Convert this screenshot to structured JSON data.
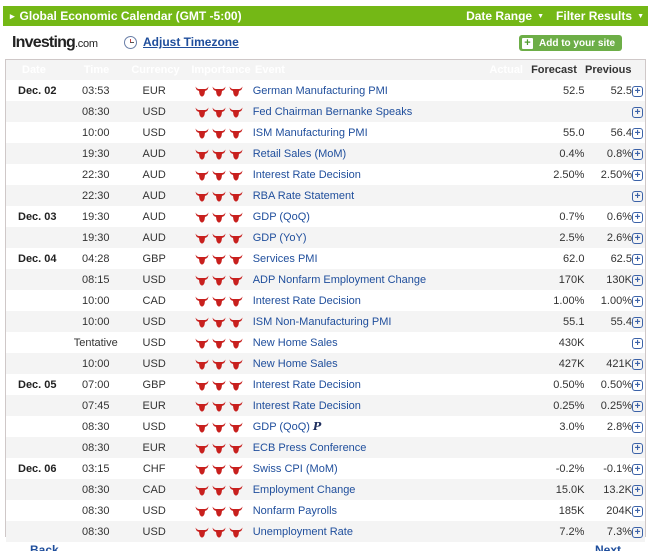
{
  "topbar": {
    "title": "Global Economic Calendar (GMT -5:00)",
    "menus": [
      {
        "label": "Date Range"
      },
      {
        "label": "Filter Results"
      }
    ]
  },
  "subbar": {
    "logo_main": "Investing",
    "logo_suffix": ".com",
    "adjust_timezone": "Adjust Timezone",
    "add_to_site": "Add to your site"
  },
  "table": {
    "headers": {
      "date": "Date",
      "time": "Time",
      "currency": "Currency",
      "importance": "Importance",
      "event": "Event",
      "actual": "Actual",
      "forecast": "Forecast",
      "previous": "Previous"
    },
    "rows": [
      {
        "date": "Dec. 02",
        "time": "03:53",
        "currency": "EUR",
        "importance": 3,
        "event": "German Manufacturing PMI",
        "actual": "",
        "forecast": "52.5",
        "previous": "52.5"
      },
      {
        "date": "",
        "time": "08:30",
        "currency": "USD",
        "importance": 3,
        "event": "Fed Chairman Bernanke Speaks",
        "actual": "",
        "forecast": "",
        "previous": ""
      },
      {
        "date": "",
        "time": "10:00",
        "currency": "USD",
        "importance": 3,
        "event": "ISM Manufacturing PMI",
        "actual": "",
        "forecast": "55.0",
        "previous": "56.4"
      },
      {
        "date": "",
        "time": "19:30",
        "currency": "AUD",
        "importance": 3,
        "event": "Retail Sales (MoM)",
        "actual": "",
        "forecast": "0.4%",
        "previous": "0.8%"
      },
      {
        "date": "",
        "time": "22:30",
        "currency": "AUD",
        "importance": 3,
        "event": "Interest Rate Decision",
        "actual": "",
        "forecast": "2.50%",
        "previous": "2.50%"
      },
      {
        "date": "",
        "time": "22:30",
        "currency": "AUD",
        "importance": 3,
        "event": "RBA Rate Statement",
        "actual": "",
        "forecast": "",
        "previous": ""
      },
      {
        "date": "Dec. 03",
        "time": "19:30",
        "currency": "AUD",
        "importance": 3,
        "event": "GDP (QoQ)",
        "actual": "",
        "forecast": "0.7%",
        "previous": "0.6%"
      },
      {
        "date": "",
        "time": "19:30",
        "currency": "AUD",
        "importance": 3,
        "event": "GDP (YoY)",
        "actual": "",
        "forecast": "2.5%",
        "previous": "2.6%"
      },
      {
        "date": "Dec. 04",
        "time": "04:28",
        "currency": "GBP",
        "importance": 3,
        "event": "Services PMI",
        "actual": "",
        "forecast": "62.0",
        "previous": "62.5"
      },
      {
        "date": "",
        "time": "08:15",
        "currency": "USD",
        "importance": 3,
        "event": "ADP Nonfarm Employment Change",
        "actual": "",
        "forecast": "170K",
        "previous": "130K"
      },
      {
        "date": "",
        "time": "10:00",
        "currency": "CAD",
        "importance": 3,
        "event": "Interest Rate Decision",
        "actual": "",
        "forecast": "1.00%",
        "previous": "1.00%"
      },
      {
        "date": "",
        "time": "10:00",
        "currency": "USD",
        "importance": 3,
        "event": "ISM Non-Manufacturing PMI",
        "actual": "",
        "forecast": "55.1",
        "previous": "55.4"
      },
      {
        "date": "",
        "time": "Tentative",
        "currency": "USD",
        "importance": 3,
        "event": "New Home Sales",
        "actual": "",
        "forecast": "430K",
        "previous": ""
      },
      {
        "date": "",
        "time": "10:00",
        "currency": "USD",
        "importance": 3,
        "event": "New Home Sales",
        "actual": "",
        "forecast": "427K",
        "previous": "421K"
      },
      {
        "date": "Dec. 05",
        "time": "07:00",
        "currency": "GBP",
        "importance": 3,
        "event": "Interest Rate Decision",
        "actual": "",
        "forecast": "0.50%",
        "previous": "0.50%"
      },
      {
        "date": "",
        "time": "07:45",
        "currency": "EUR",
        "importance": 3,
        "event": "Interest Rate Decision",
        "actual": "",
        "forecast": "0.25%",
        "previous": "0.25%"
      },
      {
        "date": "",
        "time": "08:30",
        "currency": "USD",
        "importance": 3,
        "event": "GDP (QoQ)",
        "prelim": "P",
        "actual": "",
        "forecast": "3.0%",
        "previous": "2.8%"
      },
      {
        "date": "",
        "time": "08:30",
        "currency": "EUR",
        "importance": 3,
        "event": "ECB Press Conference",
        "actual": "",
        "forecast": "",
        "previous": ""
      },
      {
        "date": "Dec. 06",
        "time": "03:15",
        "currency": "CHF",
        "importance": 3,
        "event": "Swiss CPI (MoM)",
        "actual": "",
        "forecast": "-0.2%",
        "previous": "-0.1%"
      },
      {
        "date": "",
        "time": "08:30",
        "currency": "CAD",
        "importance": 3,
        "event": "Employment Change",
        "actual": "",
        "forecast": "15.0K",
        "previous": "13.2K"
      },
      {
        "date": "",
        "time": "08:30",
        "currency": "USD",
        "importance": 3,
        "event": "Nonfarm Payrolls",
        "actual": "",
        "forecast": "185K",
        "previous": "204K"
      },
      {
        "date": "",
        "time": "08:30",
        "currency": "USD",
        "importance": 3,
        "event": "Unemployment Rate",
        "actual": "",
        "forecast": "7.2%",
        "previous": "7.3%"
      }
    ]
  },
  "footer": {
    "back": "Back",
    "next": "Next"
  },
  "colors": {
    "header_green": "#74b816",
    "bull_red": "#c8201e",
    "link_blue": "#1f4e9c",
    "add_button_green": "#6dae47"
  }
}
